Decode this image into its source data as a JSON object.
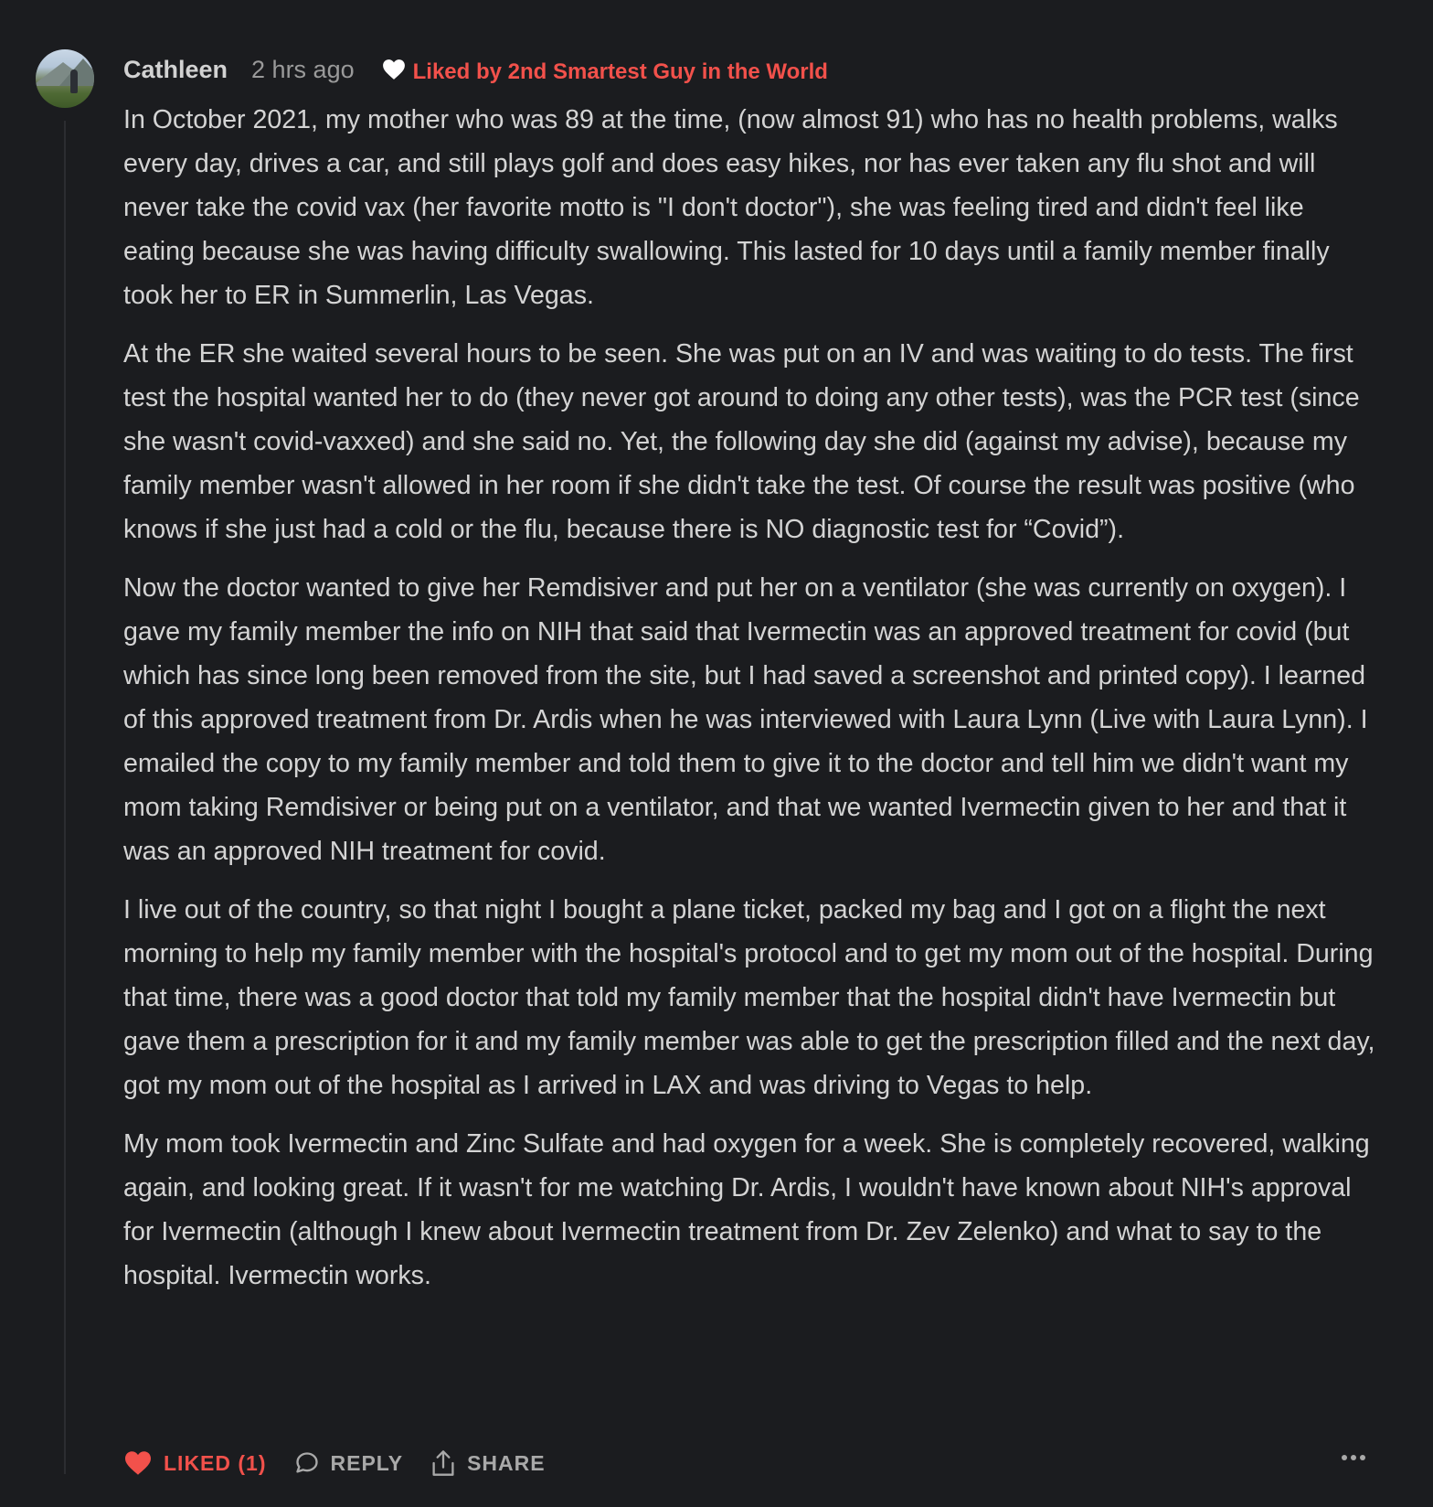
{
  "comment": {
    "author": "Cathleen",
    "time": "2 hrs ago",
    "liked_by": "Liked by 2nd Smartest Guy in the World",
    "paragraphs": [
      "In October 2021, my mother who was 89 at the time, (now almost 91) who has no health problems, walks every day, drives a car, and still plays golf and does easy hikes, nor has ever taken any flu shot and will never take the covid vax (her favorite motto is \"I don't doctor\"), she was feeling tired and didn't feel like eating because she was having difficulty swallowing. This lasted for 10 days until a family member finally took her to ER in Summerlin, Las Vegas.",
      "At the ER she waited several hours to be seen. She was put on an IV and was waiting to do tests. The first test the hospital wanted her to do (they never got around to doing any other tests), was the PCR test (since she wasn't covid-vaxxed) and she said no. Yet, the following day she did (against my advise), because my family member wasn't allowed in her room if she didn't take the test. Of course the result was positive (who knows if she just had a cold or the flu, because there is NO diagnostic test for “Covid”).",
      "Now the doctor wanted to give her Remdisiver and put her on a ventilator (she was currently on oxygen). I gave my family member the info on NIH that said that Ivermectin was an approved treatment for covid (but which has since long been removed from the site, but I had saved a screenshot and printed copy). I learned of this approved treatment from Dr. Ardis when he was interviewed with Laura Lynn (Live with Laura Lynn). I emailed the copy to my family member and told them to give it to the doctor and tell him we didn't want my mom taking Remdisiver or being put on a ventilator, and that we wanted Ivermectin given to her and that it was an approved NIH treatment for covid.",
      "I live out of the country, so that night I bought a plane ticket, packed my bag and I got on a flight the next morning to help my family member with the hospital's protocol and to get my mom out of the hospital. During that time, there was a good doctor that told my family member that the hospital didn't have Ivermectin but gave them a prescription for it and my family member was able to get the prescription filled and the next day, got my mom out of the hospital as I arrived in LAX and was driving to Vegas to help.",
      "My mom took Ivermectin and Zinc Sulfate and had oxygen for a week. She is completely recovered, walking again, and looking great. If it wasn't for me watching Dr. Ardis, I wouldn't have known about NIH's approval for Ivermectin (although I knew about Ivermectin treatment from Dr. Zev Zelenko) and what to say to the hospital. Ivermectin works."
    ]
  },
  "actions": {
    "like_label": "LIKED (1)",
    "reply_label": "REPLY",
    "share_label": "SHARE"
  },
  "icons": {
    "heart": "heart-icon",
    "reply": "speech-bubble-icon",
    "share": "share-icon",
    "more": "more-dots-icon"
  },
  "colors": {
    "background": "#1b1c1f",
    "accent": "#f2514b",
    "text": "#d4d4d4",
    "muted": "#9a9a9a"
  }
}
